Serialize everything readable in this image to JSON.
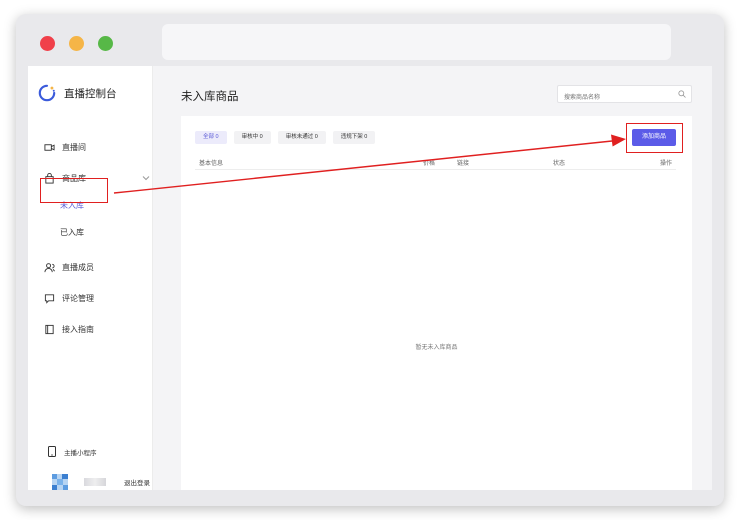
{
  "window": {
    "traffic_lights": [
      "close",
      "minimize",
      "zoom"
    ]
  },
  "sidebar": {
    "app_title": "直播控制台",
    "items": [
      {
        "label": "直播间",
        "icon": "video-camera-icon"
      },
      {
        "label": "商品库",
        "icon": "shopping-bag-icon",
        "expanded": true,
        "children": [
          {
            "label": "未入库",
            "active": true
          },
          {
            "label": "已入库"
          }
        ]
      },
      {
        "label": "直播成员",
        "icon": "members-icon"
      },
      {
        "label": "评论管理",
        "icon": "comment-icon"
      },
      {
        "label": "接入指南",
        "icon": "book-icon"
      }
    ],
    "mini_app": "主播小程序",
    "logout": "退出登录"
  },
  "main": {
    "page_title": "未入库商品",
    "search_placeholder": "搜索商品名称",
    "filter_tabs": [
      {
        "label": "全部 0",
        "active": true
      },
      {
        "label": "审核中 0"
      },
      {
        "label": "审核未通过 0"
      },
      {
        "label": "违规下架 0"
      }
    ],
    "add_button": "添加商品",
    "table_headers": [
      "基本信息",
      "价格",
      "链接",
      "状态",
      "操作"
    ],
    "empty_text": "暂无未入库商品"
  },
  "colors": {
    "accent": "#5b5be8",
    "annotation": "#e02020"
  }
}
